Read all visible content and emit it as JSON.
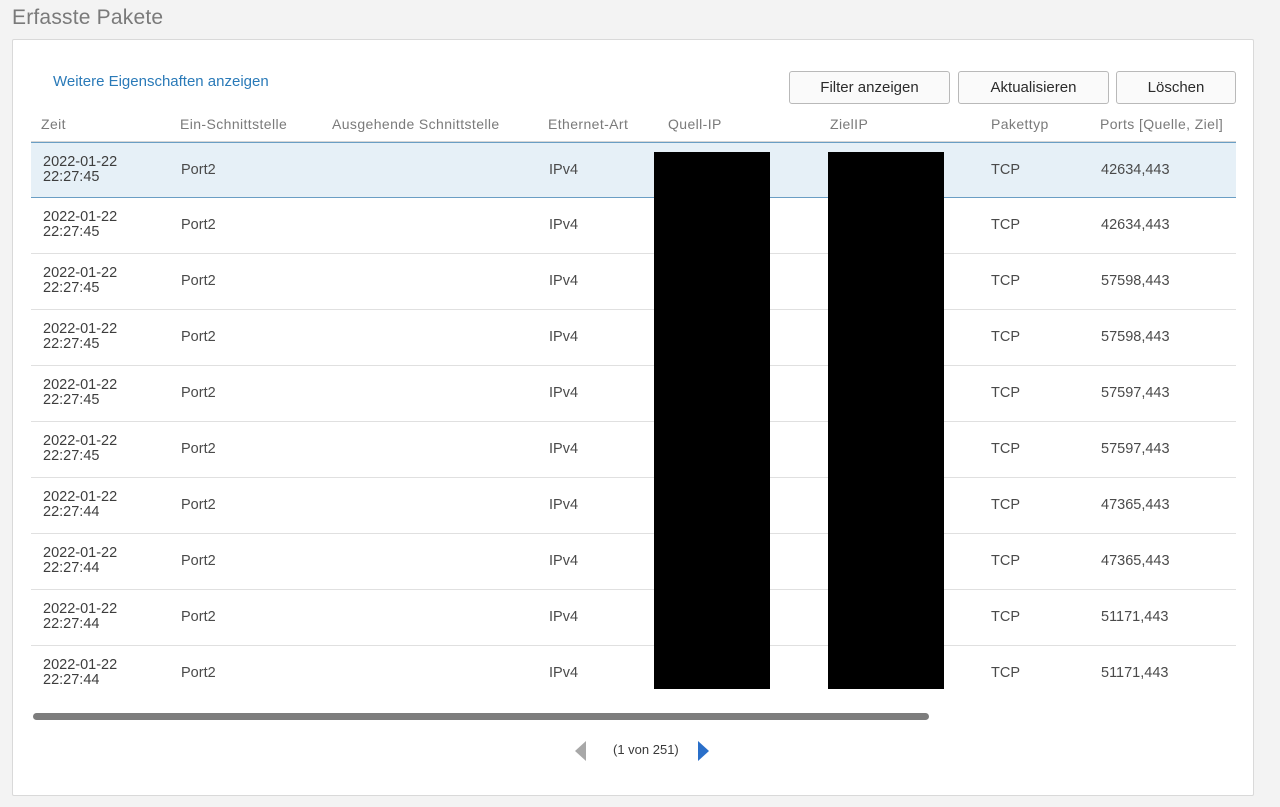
{
  "page": {
    "title": "Erfasste Pakete"
  },
  "toolbar": {
    "more_properties_label": "Weitere Eigenschaften anzeigen",
    "filter_label": "Filter anzeigen",
    "refresh_label": "Aktualisieren",
    "delete_label": "Löschen"
  },
  "table": {
    "columns": [
      "Zeit",
      "Ein-Schnittstelle",
      "Ausgehende Schnittstelle",
      "Ethernet-Art",
      "Quell-IP",
      "ZielIP",
      "Pakettyp",
      "Ports [Quelle, Ziel]"
    ],
    "rows": [
      {
        "date": "2022-01-22",
        "time": "22:27:45",
        "in_if": "Port2",
        "out_if": "",
        "eth": "IPv4",
        "type": "TCP",
        "ports": "42634,443"
      },
      {
        "date": "2022-01-22",
        "time": "22:27:45",
        "in_if": "Port2",
        "out_if": "",
        "eth": "IPv4",
        "type": "TCP",
        "ports": "42634,443"
      },
      {
        "date": "2022-01-22",
        "time": "22:27:45",
        "in_if": "Port2",
        "out_if": "",
        "eth": "IPv4",
        "type": "TCP",
        "ports": "57598,443"
      },
      {
        "date": "2022-01-22",
        "time": "22:27:45",
        "in_if": "Port2",
        "out_if": "",
        "eth": "IPv4",
        "type": "TCP",
        "ports": "57598,443"
      },
      {
        "date": "2022-01-22",
        "time": "22:27:45",
        "in_if": "Port2",
        "out_if": "",
        "eth": "IPv4",
        "type": "TCP",
        "ports": "57597,443"
      },
      {
        "date": "2022-01-22",
        "time": "22:27:45",
        "in_if": "Port2",
        "out_if": "",
        "eth": "IPv4",
        "type": "TCP",
        "ports": "57597,443"
      },
      {
        "date": "2022-01-22",
        "time": "22:27:44",
        "in_if": "Port2",
        "out_if": "",
        "eth": "IPv4",
        "type": "TCP",
        "ports": "47365,443"
      },
      {
        "date": "2022-01-22",
        "time": "22:27:44",
        "in_if": "Port2",
        "out_if": "",
        "eth": "IPv4",
        "type": "TCP",
        "ports": "47365,443"
      },
      {
        "date": "2022-01-22",
        "time": "22:27:44",
        "in_if": "Port2",
        "out_if": "",
        "eth": "IPv4",
        "type": "TCP",
        "ports": "51171,443"
      },
      {
        "date": "2022-01-22",
        "time": "22:27:44",
        "in_if": "Port2",
        "out_if": "",
        "eth": "IPv4",
        "type": "TCP",
        "ports": "51171,443"
      }
    ]
  },
  "pager": {
    "info": "(1 von 251)"
  }
}
